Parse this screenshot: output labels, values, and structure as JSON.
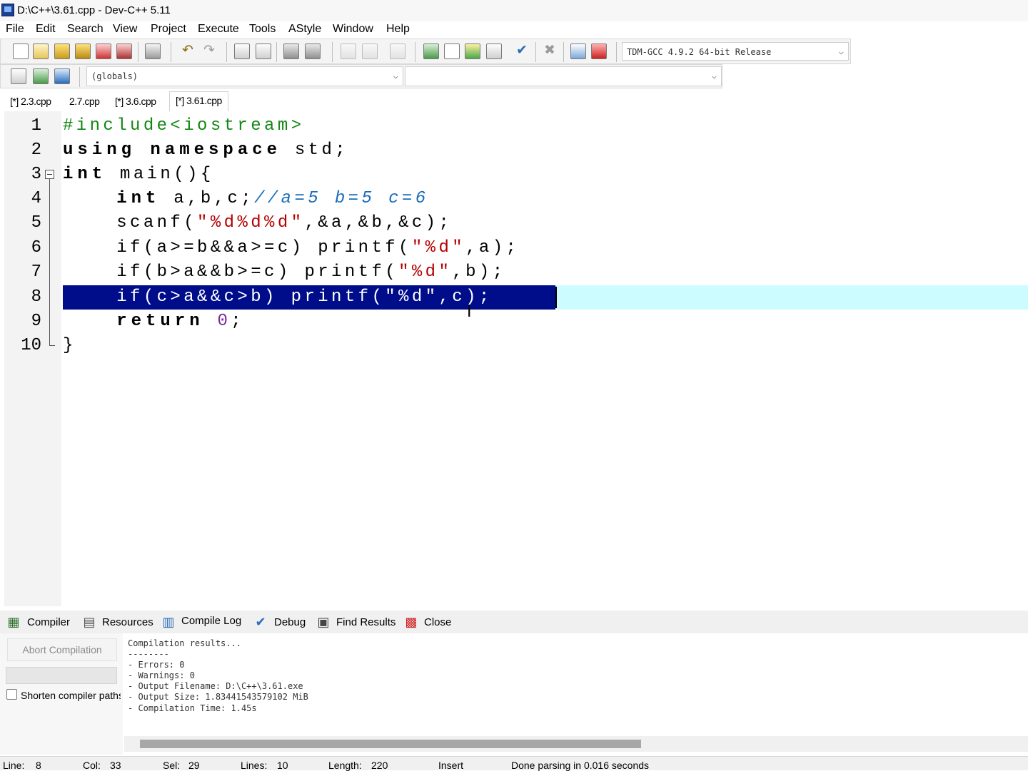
{
  "window": {
    "title": "D:\\C++\\3.61.cpp - Dev-C++ 5.11"
  },
  "menu": [
    "File",
    "Edit",
    "Search",
    "View",
    "Project",
    "Execute",
    "Tools",
    "AStyle",
    "Window",
    "Help"
  ],
  "toolbar": {
    "compiler": "TDM-GCC 4.9.2 64-bit Release",
    "scope": "(globals)",
    "members": ""
  },
  "tabs": [
    "[*] 2.3.cpp",
    "2.7.cpp",
    "[*] 3.6.cpp",
    "[*] 3.61.cpp"
  ],
  "editor": {
    "line_numbers": [
      "1",
      "2",
      "3",
      "4",
      "5",
      "6",
      "7",
      "8",
      "9",
      "10"
    ],
    "selected_line": 8
  },
  "panel": {
    "tabs": [
      "Compiler",
      "Resources",
      "Compile Log",
      "Debug",
      "Find Results",
      "Close"
    ],
    "abort_label": "Abort Compilation",
    "shorten_label": "Shorten compiler paths",
    "log": [
      "Compilation results...",
      "--------",
      "- Errors: 0",
      "- Warnings: 0",
      "- Output Filename: D:\\C++\\3.61.exe",
      "- Output Size: 1.83441543579102 MiB",
      "- Compilation Time: 1.45s"
    ]
  },
  "status": {
    "line_label": "Line:",
    "line": "8",
    "col_label": "Col:",
    "col": "33",
    "sel_label": "Sel:",
    "sel": "29",
    "lines_label": "Lines:",
    "lines": "10",
    "length_label": "Length:",
    "length": "220",
    "mode": "Insert",
    "message": "Done parsing in 0.016 seconds"
  }
}
